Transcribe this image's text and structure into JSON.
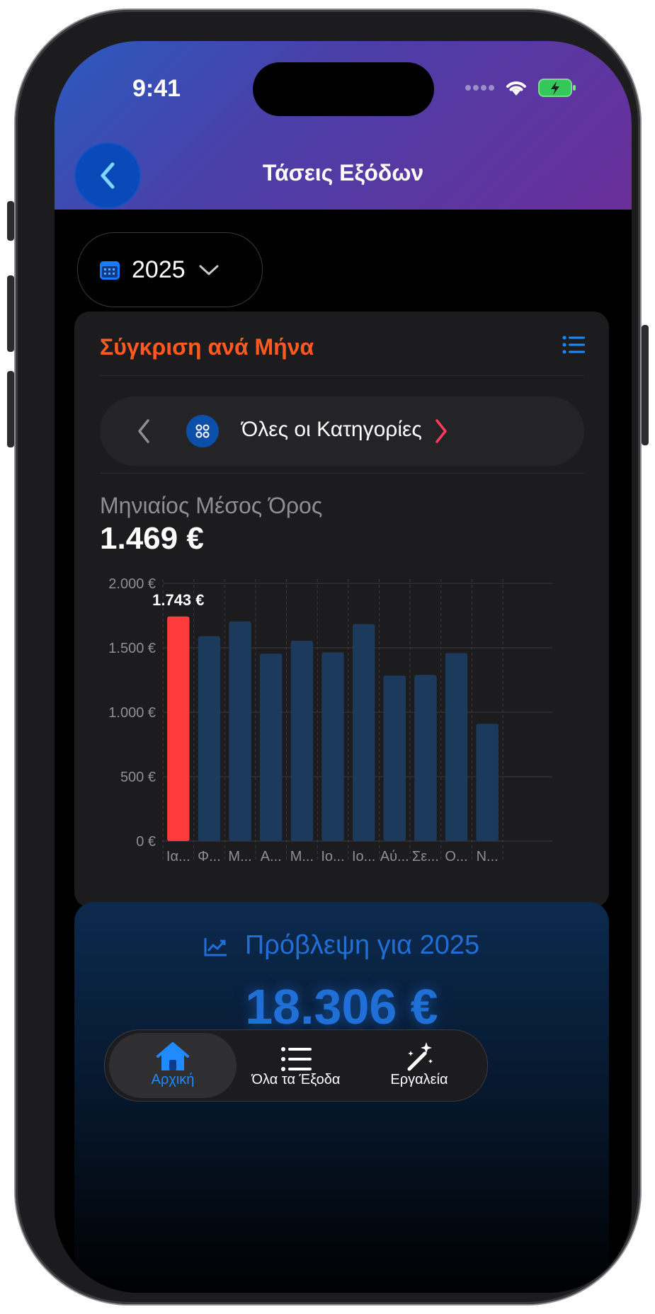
{
  "status": {
    "time": "9:41"
  },
  "header": {
    "title": "Τάσεις Εξόδων"
  },
  "year_selector": {
    "value": "2025"
  },
  "comparison_card": {
    "title": "Σύγκριση ανά Μήνα",
    "category_label": "Όλες οι Κατηγορίες",
    "avg_label": "Μηνιαίος Μέσος Όρος",
    "avg_value": "1.469 €"
  },
  "chart_data": {
    "type": "bar",
    "categories": [
      "Ια...",
      "Φ...",
      "Μ...",
      "Α...",
      "Μ...",
      "Ιο...",
      "Ιο...",
      "Αύ...",
      "Σε...",
      "Ο...",
      "Ν..."
    ],
    "values": [
      1743,
      1590,
      1705,
      1455,
      1555,
      1465,
      1685,
      1285,
      1290,
      1460,
      910
    ],
    "highlight_index": 0,
    "highlight_label": "1.743 €",
    "ylim": [
      0,
      2000
    ],
    "y_ticks": [
      "0 €",
      "500 €",
      "1.000 €",
      "1.500 €",
      "2.000 €"
    ],
    "grid": true,
    "colors": {
      "bar": "#1b3a5c",
      "highlight": "#ff3b3b"
    }
  },
  "forecast": {
    "title": "Πρόβλεψη για 2025",
    "value": "18.306 €"
  },
  "tabs": [
    {
      "label": "Αρχική",
      "icon": "house-icon",
      "active": true
    },
    {
      "label": "Όλα τα Έξοδα",
      "icon": "list-icon",
      "active": false
    },
    {
      "label": "Εργαλεία",
      "icon": "magic-wand-icon",
      "active": false
    }
  ]
}
